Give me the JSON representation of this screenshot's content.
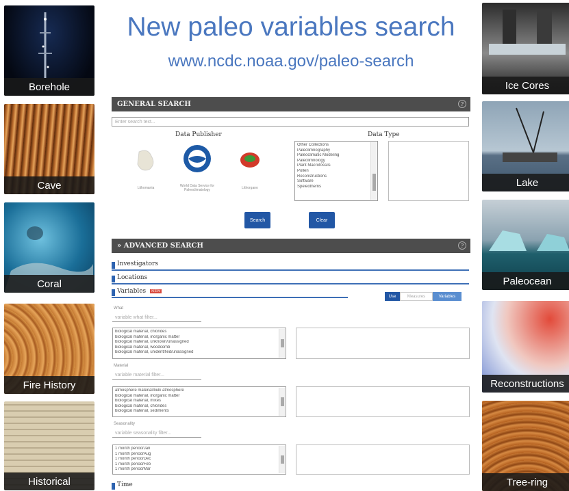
{
  "header": {
    "title": "New paleo variables search",
    "url": "www.ncdc.noaa.gov/paleo-search"
  },
  "left_tiles": [
    {
      "label": "Borehole"
    },
    {
      "label": "Cave"
    },
    {
      "label": "Coral"
    },
    {
      "label": "Fire History"
    },
    {
      "label": "Historical"
    }
  ],
  "right_tiles": [
    {
      "label": "Ice Cores"
    },
    {
      "label": "Lake"
    },
    {
      "label": "Paleocean"
    },
    {
      "label": "Reconstructions"
    },
    {
      "label": "Tree-ring"
    }
  ],
  "general_search": {
    "heading": "GENERAL SEARCH",
    "placeholder": "Enter search text...",
    "publisher_label": "Data Publisher",
    "publishers": [
      "Lithomania",
      "World Data Service for Paleoclimatology",
      "Lithorgano"
    ],
    "data_type_label": "Data Type",
    "data_types": [
      "Other Collections",
      "Paleolimnography",
      "Paleoclimatic Modeling",
      "Paleolimnology",
      "Plant Macrofossils",
      "Pollen",
      "Reconstructions",
      "Software",
      "Speleothems"
    ],
    "search_button": "Search",
    "clear_button": "Clear"
  },
  "advanced_search": {
    "heading": "» ADVANCED SEARCH",
    "sections": [
      "Investigators",
      "Locations",
      "Variables",
      "Time"
    ],
    "new_badge": "NEW",
    "toggle": [
      "Use",
      "Measures",
      "Variables"
    ],
    "what": {
      "label": "What",
      "placeholder": "variable what filter...",
      "items": [
        "biological material, chlorides",
        "biological material, inorganic matter",
        "biological material, unknown/unassigned",
        "biological material, woodcomb",
        "biological material, unidentified/unassigned"
      ]
    },
    "material": {
      "label": "Material",
      "placeholder": "variable material filter...",
      "items": [
        "atmosphere material/bulk atmosphere",
        "biological material, inorganic matter",
        "biological material, mixes",
        "biological material, chlorides",
        "biological material, sediments"
      ]
    },
    "seasonality": {
      "label": "Seasonality",
      "placeholder": "variable seasonality filter...",
      "items": [
        "1 month period/Jan",
        "1 month period/Aug",
        "1 month period/Dec",
        "1 month period/Feb",
        "1 month period/Mar"
      ]
    }
  },
  "colors": {
    "accent": "#4a77bf",
    "bar": "#4d4d4d",
    "button": "#2257a5"
  }
}
